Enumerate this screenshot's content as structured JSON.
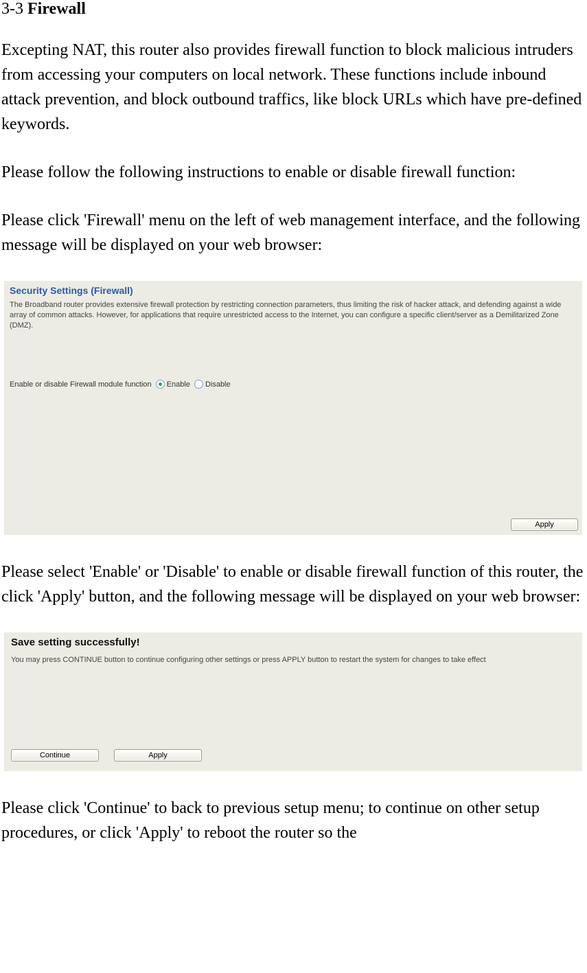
{
  "section": {
    "number": "3-3",
    "name": "Firewall"
  },
  "paragraphs": {
    "p1": "Excepting NAT, this router also provides firewall function to block malicious intruders from accessing your computers on local network. These functions include inbound attack prevention, and block outbound traffics, like block URLs which have pre-defined keywords.",
    "p2": "Please follow the following instructions to enable or disable firewall function:",
    "p3": "Please click 'Firewall' menu on the left of web management interface, and the following message will be displayed on your web browser:",
    "p4": "Please select 'Enable' or 'Disable' to enable or disable firewall function of this router, the click 'Apply' button, and the following message will be displayed on your web browser:",
    "p5": "Please click 'Continue' to back to previous setup menu; to continue on other setup procedures, or click 'Apply' to reboot the router so the"
  },
  "firewall_panel": {
    "title": "Security Settings (Firewall)",
    "description": "The Broadband router provides extensive firewall protection by restricting connection parameters, thus limiting the risk of hacker attack, and defending against a wide array of common attacks. However, for applications that require unrestricted access to the Internet, you can configure a specific client/server as a Demilitarized Zone (DMZ).",
    "field_label": "Enable or disable Firewall module function",
    "option_enable": "Enable",
    "option_disable": "Disable",
    "apply_label": "Apply"
  },
  "save_panel": {
    "title": "Save setting successfully!",
    "description": "You may press CONTINUE button to continue configuring other settings or press APPLY button to restart the system for changes to take effect",
    "continue_label": "Continue",
    "apply_label": "Apply"
  }
}
